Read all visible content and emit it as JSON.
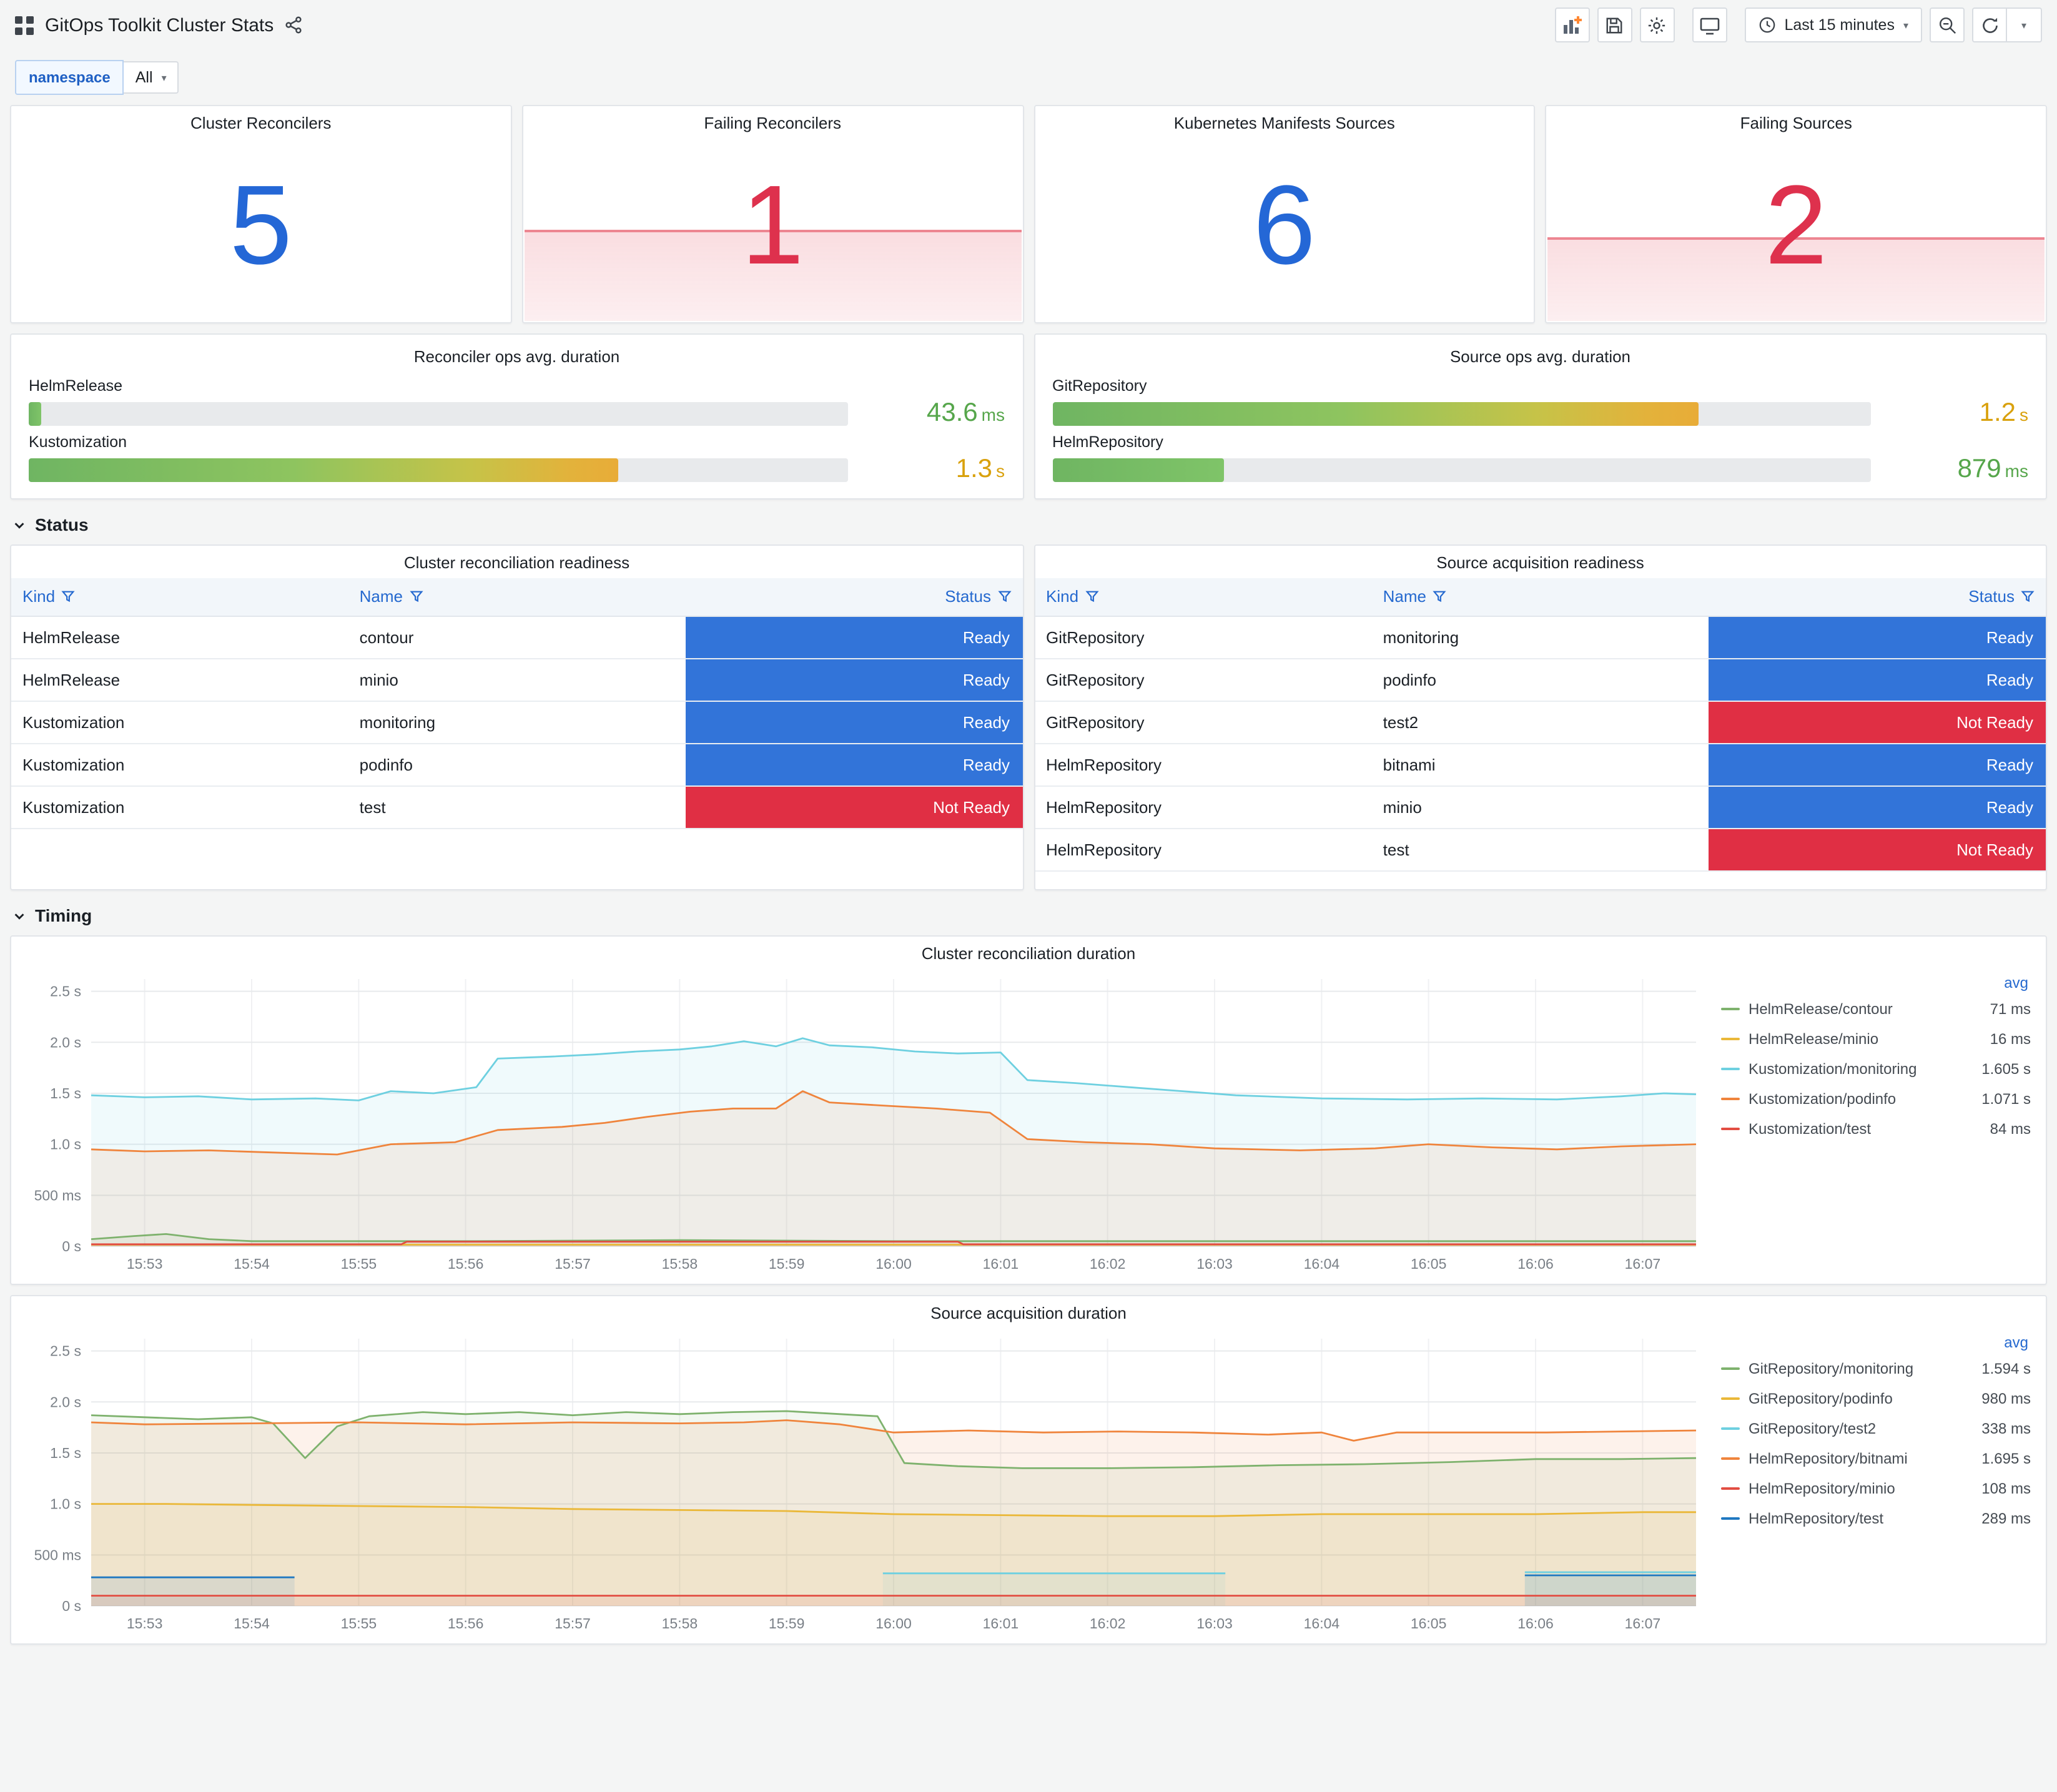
{
  "header": {
    "title": "GitOps Toolkit Cluster Stats"
  },
  "toolbar": {
    "time_range": "Last 15 minutes"
  },
  "variables": {
    "namespace_label": "namespace",
    "namespace_value": "All"
  },
  "sections": {
    "status": "Status",
    "timing": "Timing"
  },
  "colors": {
    "ready": "#3274D9",
    "not_ready": "#E02F44",
    "stat_blue": "#2467D6",
    "stat_red": "#DE314D"
  },
  "stat_panels": [
    {
      "title": "Cluster Reconcilers",
      "value": "5",
      "tone": "blue"
    },
    {
      "title": "Failing Reconcilers",
      "value": "1",
      "tone": "red",
      "spark_height_pct": 42
    },
    {
      "title": "Kubernetes Manifests Sources",
      "value": "6",
      "tone": "blue"
    },
    {
      "title": "Failing Sources",
      "value": "2",
      "tone": "red",
      "spark_height_pct": 39
    }
  ],
  "gauge_panels": [
    {
      "title": "Reconciler ops avg. duration",
      "rows": [
        {
          "label": "HelmRelease",
          "value": "43.6",
          "unit": "ms",
          "pct": 1.6,
          "tone": "green",
          "fill": "green"
        },
        {
          "label": "Kustomization",
          "value": "1.3",
          "unit": "s",
          "pct": 72,
          "tone": "yellow",
          "fill": "mixed"
        }
      ]
    },
    {
      "title": "Source ops avg. duration",
      "rows": [
        {
          "label": "GitRepository",
          "value": "1.2",
          "unit": "s",
          "pct": 79,
          "tone": "yellow",
          "fill": "mixed"
        },
        {
          "label": "HelmRepository",
          "value": "879",
          "unit": "ms",
          "pct": 21,
          "tone": "green",
          "fill": "green"
        }
      ]
    }
  ],
  "table_panels": [
    {
      "title": "Cluster reconciliation readiness",
      "columns": [
        "Kind",
        "Name",
        "Status"
      ],
      "rows": [
        [
          "HelmRelease",
          "contour",
          "Ready"
        ],
        [
          "HelmRelease",
          "minio",
          "Ready"
        ],
        [
          "Kustomization",
          "monitoring",
          "Ready"
        ],
        [
          "Kustomization",
          "podinfo",
          "Ready"
        ],
        [
          "Kustomization",
          "test",
          "Not Ready"
        ]
      ]
    },
    {
      "title": "Source acquisition readiness",
      "columns": [
        "Kind",
        "Name",
        "Status"
      ],
      "rows": [
        [
          "GitRepository",
          "monitoring",
          "Ready"
        ],
        [
          "GitRepository",
          "podinfo",
          "Ready"
        ],
        [
          "GitRepository",
          "test2",
          "Not Ready"
        ],
        [
          "HelmRepository",
          "bitnami",
          "Ready"
        ],
        [
          "HelmRepository",
          "minio",
          "Ready"
        ],
        [
          "HelmRepository",
          "test",
          "Not Ready"
        ]
      ]
    }
  ],
  "chart_data": [
    {
      "type": "line",
      "title": "Cluster reconciliation duration",
      "legend_header": "avg",
      "ylim": [
        0,
        2.62
      ],
      "x_range": [
        0.5,
        15.5
      ],
      "y_ticks": [
        [
          0,
          "0 s"
        ],
        [
          0.5,
          "500 ms"
        ],
        [
          1,
          "1.0 s"
        ],
        [
          1.5,
          "1.5 s"
        ],
        [
          2,
          "2.0 s"
        ],
        [
          2.5,
          "2.5 s"
        ]
      ],
      "x_ticks": [
        [
          1,
          "15:53"
        ],
        [
          2,
          "15:54"
        ],
        [
          3,
          "15:55"
        ],
        [
          4,
          "15:56"
        ],
        [
          5,
          "15:57"
        ],
        [
          6,
          "15:58"
        ],
        [
          7,
          "15:59"
        ],
        [
          8,
          "16:00"
        ],
        [
          9,
          "16:01"
        ],
        [
          10,
          "16:02"
        ],
        [
          11,
          "16:03"
        ],
        [
          12,
          "16:04"
        ],
        [
          13,
          "16:05"
        ],
        [
          14,
          "16:06"
        ],
        [
          15,
          "16:07"
        ]
      ],
      "series": [
        {
          "name": "HelmRelease/contour",
          "color": "#7EB26D",
          "avg": "71 ms",
          "points": [
            [
              0.5,
              0.07
            ],
            [
              0.9,
              0.1
            ],
            [
              1.2,
              0.12
            ],
            [
              1.6,
              0.07
            ],
            [
              2,
              0.05
            ],
            [
              4,
              0.05
            ],
            [
              6,
              0.06
            ],
            [
              8,
              0.05
            ],
            [
              10,
              0.05
            ],
            [
              12,
              0.05
            ],
            [
              14,
              0.05
            ],
            [
              15.5,
              0.05
            ]
          ]
        },
        {
          "name": "HelmRelease/minio",
          "color": "#EAB839",
          "avg": "16 ms",
          "points": [
            [
              0.5,
              0.016
            ],
            [
              15.5,
              0.016
            ]
          ]
        },
        {
          "name": "Kustomization/monitoring",
          "color": "#6ED0E0",
          "avg": "1.605 s",
          "points": [
            [
              0.5,
              1.48
            ],
            [
              1,
              1.46
            ],
            [
              1.5,
              1.47
            ],
            [
              2,
              1.44
            ],
            [
              2.6,
              1.45
            ],
            [
              3,
              1.43
            ],
            [
              3.3,
              1.52
            ],
            [
              3.7,
              1.5
            ],
            [
              4.1,
              1.56
            ],
            [
              4.3,
              1.84
            ],
            [
              4.8,
              1.86
            ],
            [
              5.2,
              1.88
            ],
            [
              5.6,
              1.91
            ],
            [
              6,
              1.93
            ],
            [
              6.3,
              1.96
            ],
            [
              6.6,
              2.01
            ],
            [
              6.9,
              1.96
            ],
            [
              7.15,
              2.04
            ],
            [
              7.4,
              1.97
            ],
            [
              7.8,
              1.95
            ],
            [
              8.2,
              1.91
            ],
            [
              8.6,
              1.89
            ],
            [
              9,
              1.9
            ],
            [
              9.25,
              1.63
            ],
            [
              9.7,
              1.6
            ],
            [
              10.2,
              1.56
            ],
            [
              10.7,
              1.52
            ],
            [
              11.2,
              1.48
            ],
            [
              12,
              1.45
            ],
            [
              12.8,
              1.44
            ],
            [
              13.5,
              1.45
            ],
            [
              14.2,
              1.44
            ],
            [
              14.8,
              1.47
            ],
            [
              15.2,
              1.5
            ],
            [
              15.5,
              1.49
            ]
          ]
        },
        {
          "name": "Kustomization/podinfo",
          "color": "#EF843C",
          "avg": "1.071 s",
          "points": [
            [
              0.5,
              0.95
            ],
            [
              1,
              0.93
            ],
            [
              1.6,
              0.94
            ],
            [
              2.2,
              0.92
            ],
            [
              2.8,
              0.9
            ],
            [
              3.3,
              1.0
            ],
            [
              3.9,
              1.02
            ],
            [
              4.3,
              1.14
            ],
            [
              4.9,
              1.17
            ],
            [
              5.3,
              1.21
            ],
            [
              5.7,
              1.27
            ],
            [
              6.1,
              1.32
            ],
            [
              6.5,
              1.35
            ],
            [
              6.9,
              1.35
            ],
            [
              7.15,
              1.52
            ],
            [
              7.4,
              1.41
            ],
            [
              7.9,
              1.38
            ],
            [
              8.4,
              1.35
            ],
            [
              8.9,
              1.31
            ],
            [
              9.25,
              1.05
            ],
            [
              9.8,
              1.02
            ],
            [
              10.4,
              1.0
            ],
            [
              11,
              0.96
            ],
            [
              11.8,
              0.94
            ],
            [
              12.5,
              0.96
            ],
            [
              13,
              1.0
            ],
            [
              13.6,
              0.97
            ],
            [
              14.2,
              0.95
            ],
            [
              14.8,
              0.98
            ],
            [
              15.5,
              1.0
            ]
          ]
        },
        {
          "name": "Kustomization/test",
          "color": "#E24D42",
          "avg": "84 ms",
          "points": [
            [
              0.5,
              0.02
            ],
            [
              3.4,
              0.02
            ],
            [
              3.45,
              0.045
            ],
            [
              8.6,
              0.045
            ],
            [
              8.65,
              0.02
            ],
            [
              15.5,
              0.02
            ]
          ]
        }
      ]
    },
    {
      "type": "line",
      "title": "Source acquisition duration",
      "legend_header": "avg",
      "ylim": [
        0,
        2.62
      ],
      "x_range": [
        0.5,
        15.5
      ],
      "y_ticks": [
        [
          0,
          "0 s"
        ],
        [
          0.5,
          "500 ms"
        ],
        [
          1,
          "1.0 s"
        ],
        [
          1.5,
          "1.5 s"
        ],
        [
          2,
          "2.0 s"
        ],
        [
          2.5,
          "2.5 s"
        ]
      ],
      "x_ticks": [
        [
          1,
          "15:53"
        ],
        [
          2,
          "15:54"
        ],
        [
          3,
          "15:55"
        ],
        [
          4,
          "15:56"
        ],
        [
          5,
          "15:57"
        ],
        [
          6,
          "15:58"
        ],
        [
          7,
          "15:59"
        ],
        [
          8,
          "16:00"
        ],
        [
          9,
          "16:01"
        ],
        [
          10,
          "16:02"
        ],
        [
          11,
          "16:03"
        ],
        [
          12,
          "16:04"
        ],
        [
          13,
          "16:05"
        ],
        [
          14,
          "16:06"
        ],
        [
          15,
          "16:07"
        ]
      ],
      "series": [
        {
          "name": "GitRepository/monitoring",
          "color": "#7EB26D",
          "avg": "1.594 s",
          "points": [
            [
              0.5,
              1.87
            ],
            [
              1,
              1.85
            ],
            [
              1.5,
              1.83
            ],
            [
              2,
              1.85
            ],
            [
              2.2,
              1.79
            ],
            [
              2.5,
              1.45
            ],
            [
              2.8,
              1.76
            ],
            [
              3.1,
              1.86
            ],
            [
              3.6,
              1.9
            ],
            [
              4,
              1.88
            ],
            [
              4.5,
              1.9
            ],
            [
              5,
              1.87
            ],
            [
              5.5,
              1.9
            ],
            [
              6,
              1.88
            ],
            [
              6.5,
              1.9
            ],
            [
              7,
              1.91
            ],
            [
              7.5,
              1.88
            ],
            [
              7.85,
              1.86
            ],
            [
              8.1,
              1.4
            ],
            [
              8.6,
              1.37
            ],
            [
              9.2,
              1.35
            ],
            [
              10,
              1.35
            ],
            [
              10.8,
              1.36
            ],
            [
              11.6,
              1.38
            ],
            [
              12.4,
              1.39
            ],
            [
              13.2,
              1.41
            ],
            [
              14,
              1.44
            ],
            [
              14.8,
              1.44
            ],
            [
              15.5,
              1.45
            ]
          ]
        },
        {
          "name": "GitRepository/podinfo",
          "color": "#EAB839",
          "avg": "980 ms",
          "points": [
            [
              0.5,
              1.0
            ],
            [
              1.2,
              1.0
            ],
            [
              2,
              0.99
            ],
            [
              3,
              0.98
            ],
            [
              4,
              0.97
            ],
            [
              5,
              0.95
            ],
            [
              6,
              0.94
            ],
            [
              7,
              0.93
            ],
            [
              8,
              0.9
            ],
            [
              9,
              0.89
            ],
            [
              10,
              0.88
            ],
            [
              11,
              0.88
            ],
            [
              12,
              0.9
            ],
            [
              13,
              0.9
            ],
            [
              14,
              0.9
            ],
            [
              15,
              0.92
            ],
            [
              15.5,
              0.92
            ]
          ]
        },
        {
          "name": "GitRepository/test2",
          "color": "#6ED0E0",
          "avg": "338 ms",
          "points": [
            [
              7.9,
              0.32
            ],
            [
              11.1,
              0.32
            ],
            [
              11.15,
              null
            ],
            [
              13.9,
              0.33
            ],
            [
              15.5,
              0.33
            ]
          ]
        },
        {
          "name": "HelmRepository/bitnami",
          "color": "#EF843C",
          "avg": "1.695 s",
          "points": [
            [
              0.5,
              1.8
            ],
            [
              1,
              1.78
            ],
            [
              2,
              1.79
            ],
            [
              3,
              1.8
            ],
            [
              4,
              1.78
            ],
            [
              5,
              1.8
            ],
            [
              6,
              1.79
            ],
            [
              6.6,
              1.8
            ],
            [
              7,
              1.82
            ],
            [
              7.5,
              1.78
            ],
            [
              8,
              1.7
            ],
            [
              8.7,
              1.72
            ],
            [
              9.4,
              1.7
            ],
            [
              10.1,
              1.71
            ],
            [
              10.8,
              1.7
            ],
            [
              11.5,
              1.68
            ],
            [
              12,
              1.7
            ],
            [
              12.3,
              1.62
            ],
            [
              12.7,
              1.7
            ],
            [
              13.4,
              1.7
            ],
            [
              14.1,
              1.7
            ],
            [
              14.8,
              1.71
            ],
            [
              15.5,
              1.72
            ]
          ]
        },
        {
          "name": "HelmRepository/minio",
          "color": "#E24D42",
          "avg": "108 ms",
          "points": [
            [
              0.5,
              0.1
            ],
            [
              15.5,
              0.1
            ]
          ]
        },
        {
          "name": "HelmRepository/test",
          "color": "#1F78C1",
          "avg": "289 ms",
          "points": [
            [
              0.5,
              0.28
            ],
            [
              2.4,
              0.28
            ],
            [
              2.45,
              null
            ],
            [
              13.9,
              0.3
            ],
            [
              15.5,
              0.3
            ]
          ]
        }
      ]
    }
  ]
}
